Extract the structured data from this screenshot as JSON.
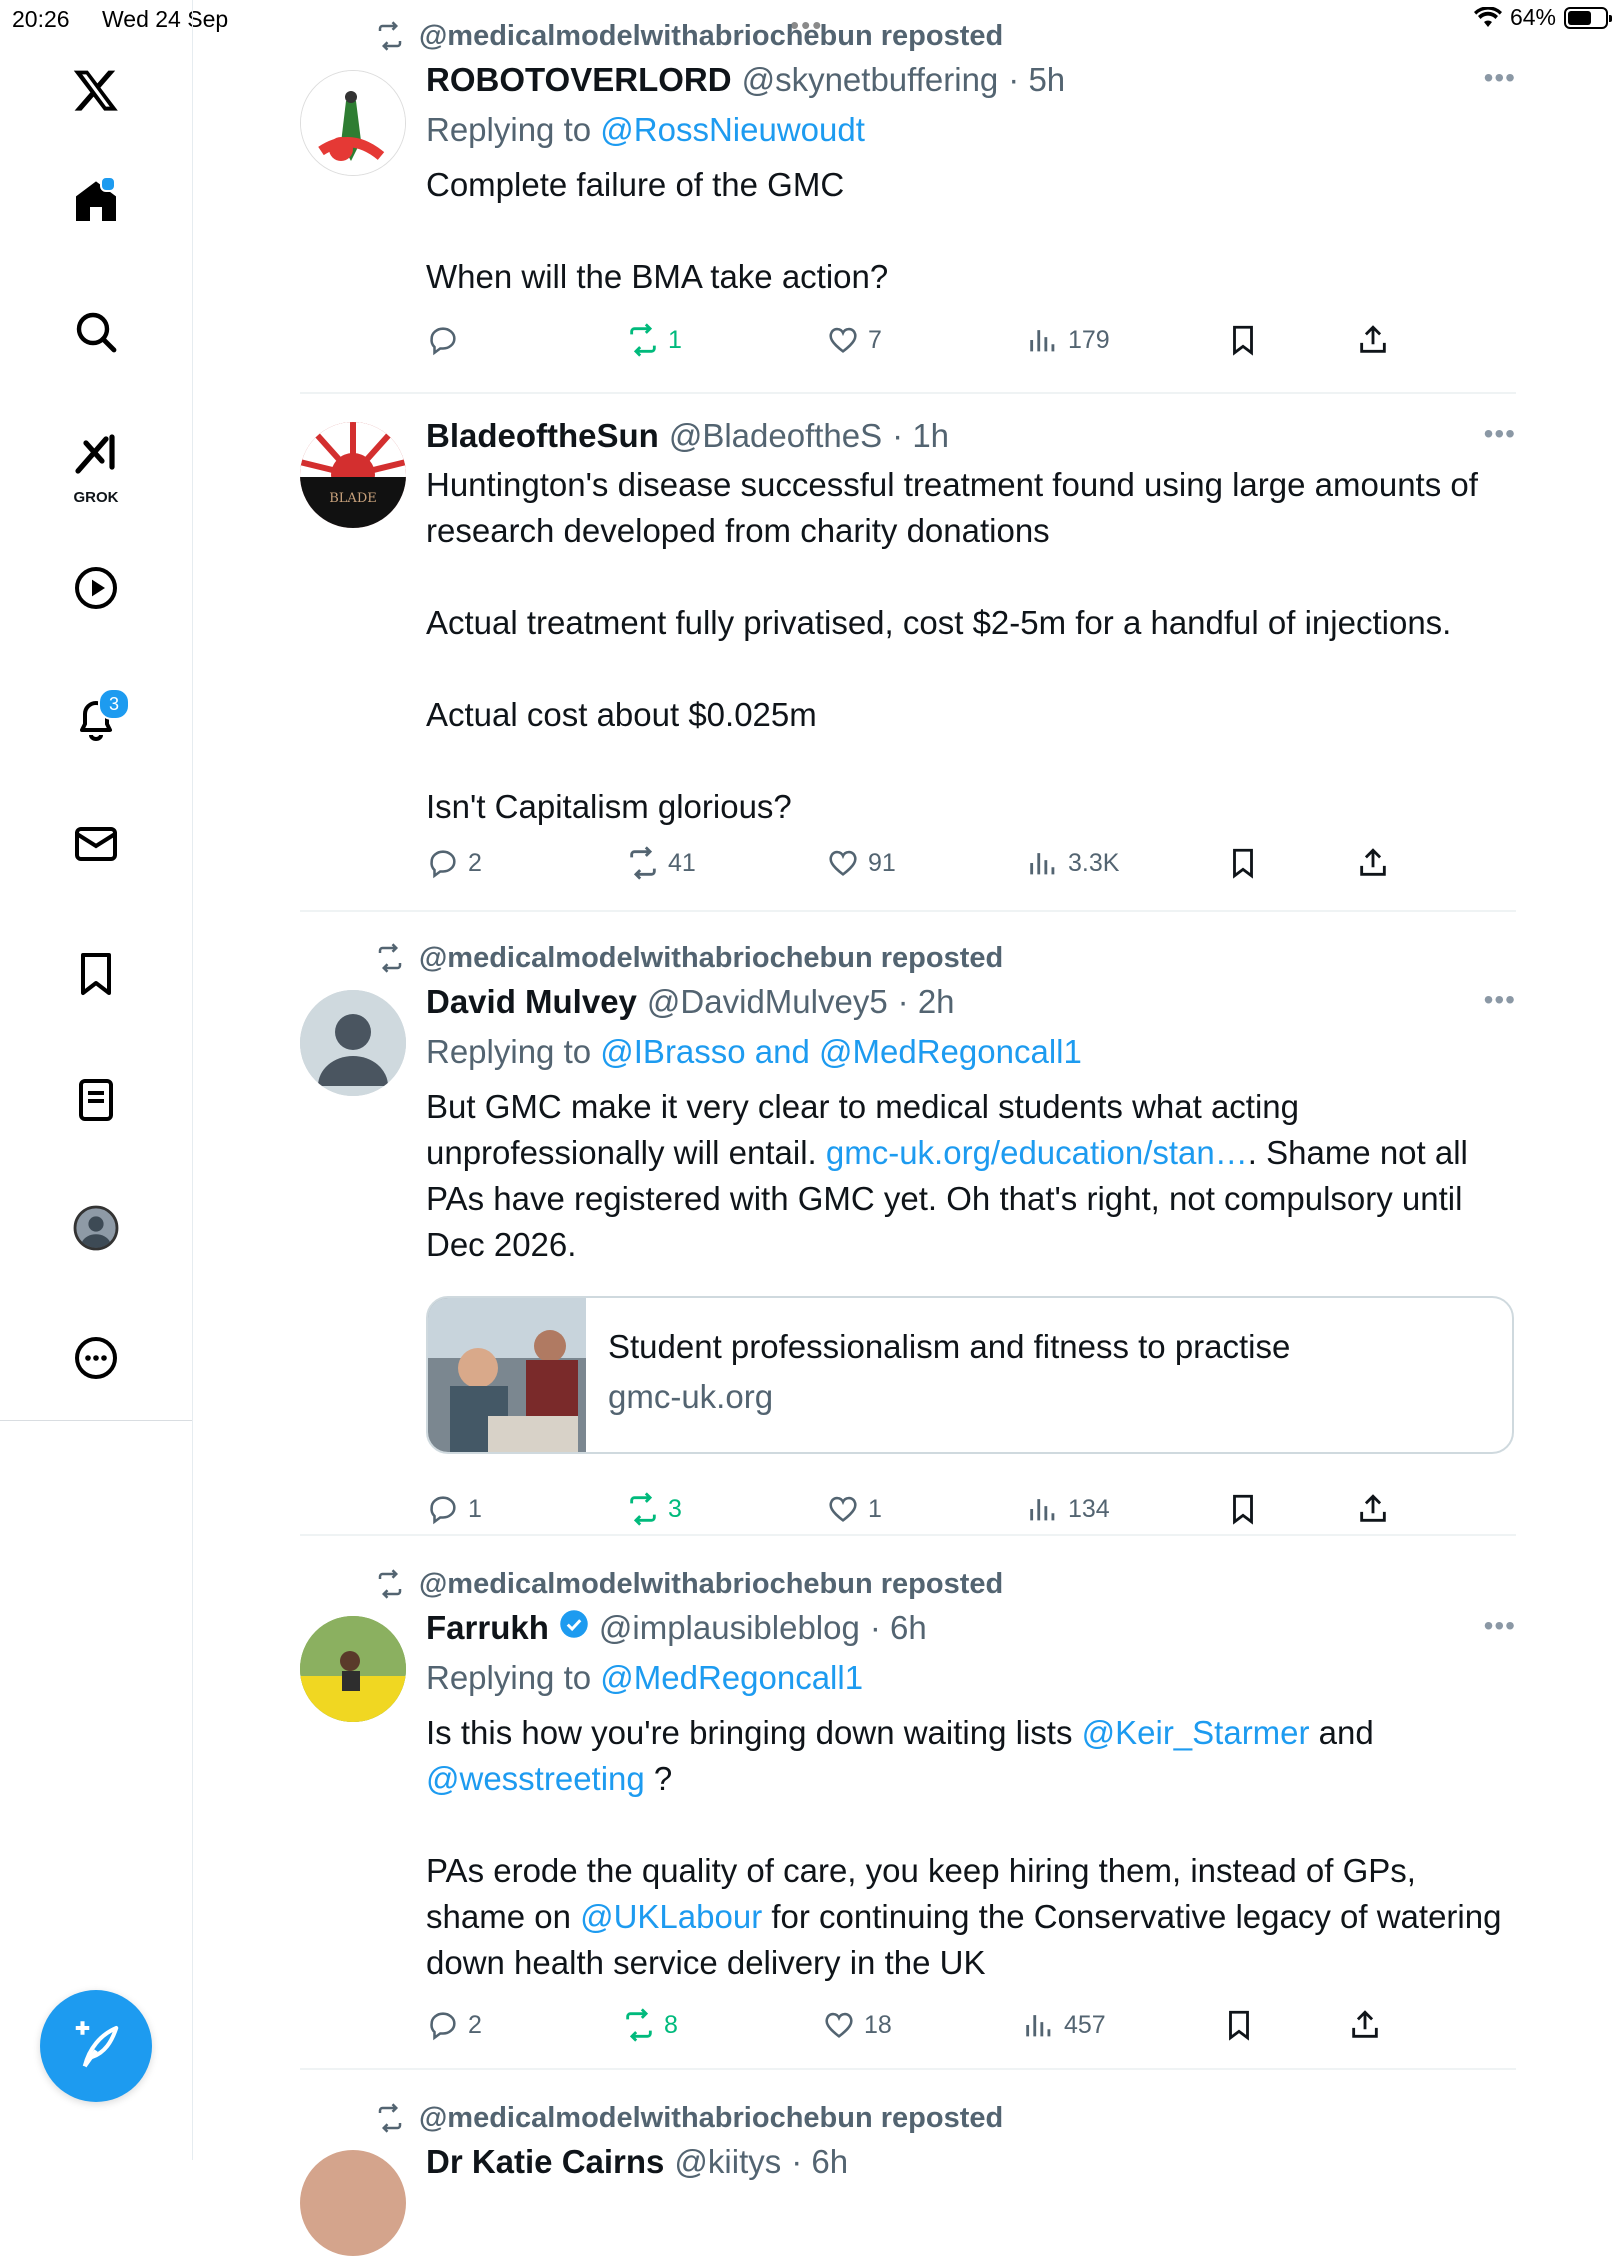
{
  "status_bar": {
    "time": "20:26",
    "date": "Wed 24 Sep",
    "battery": "64%",
    "battery_level": 0.64
  },
  "sidebar": {
    "app_logo": "X",
    "grok_label": "GROK",
    "notifications_badge": "3",
    "items": [
      "home-icon",
      "search-icon",
      "grok-icon",
      "video-icon",
      "bell-icon",
      "mail-icon",
      "bookmark-icon",
      "lists-icon",
      "profile-icon",
      "more-icon"
    ]
  },
  "posts": [
    {
      "reposted_by": "@medicalmodelwithabriochebun reposted",
      "name": "ROBOTOVERLORD",
      "handle": "@skynetbuffering",
      "time": "· 5h",
      "replying_prefix": "Replying to ",
      "replying_to": "@RossNieuwoudt",
      "text": "Complete failure of the GMC\n\nWhen will the BMA take action?",
      "replies": "",
      "reposts": "1",
      "likes": "7",
      "views": "179"
    },
    {
      "name": "BladeoftheSun",
      "handle": "@BladeoftheS",
      "time": "· 1h",
      "text": "Huntington's disease successful treatment found using large amounts of research developed from charity donations\n\nActual treatment fully privatised, cost $2-5m for a handful of injections.\n\nActual cost about $0.025m\n\nIsn't Capitalism glorious?",
      "replies": "2",
      "reposts": "41",
      "likes": "91",
      "views": "3.3K"
    },
    {
      "reposted_by": "@medicalmodelwithabriochebun reposted",
      "name": "David Mulvey",
      "handle": "@DavidMulvey5",
      "time": "· 2h",
      "replying_prefix": "Replying to ",
      "replying_to": "@IBrasso and @MedRegoncall1",
      "text_a": "But GMC make it very clear to medical students what acting unprofessionally will entail. ",
      "text_link": "gmc-uk.org/education/stan…",
      "text_b": ". Shame not all PAs have registered with GMC yet. Oh that's right, not compulsory until Dec 2026.",
      "card_title": "Student professionalism and fitness to practise",
      "card_domain": "gmc-uk.org",
      "replies": "1",
      "reposts": "3",
      "likes": "1",
      "views": "134"
    },
    {
      "reposted_by": "@medicalmodelwithabriochebun reposted",
      "name": "Farrukh",
      "handle": "@implausibleblog",
      "time": "· 6h",
      "replying_prefix": "Replying to ",
      "replying_to": "@MedRegoncall1",
      "t1": "Is this how you're bringing down waiting lists ",
      "m1": "@Keir_Starmer",
      "t2": " and ",
      "m2": "@wesstreeting",
      "t3": " ?\n\nPAs erode the quality of care, you keep hiring them, instead of GPs, shame on ",
      "m3": "@UKLabour",
      "t4": " for continuing the Conservative legacy of watering down health service delivery in the UK",
      "replies": "2",
      "reposts": "8",
      "likes": "18",
      "views": "457"
    },
    {
      "reposted_by": "@medicalmodelwithabriochebun reposted",
      "name": "Dr Katie Cairns",
      "handle": "@kiitys",
      "time": "· 6h"
    }
  ]
}
